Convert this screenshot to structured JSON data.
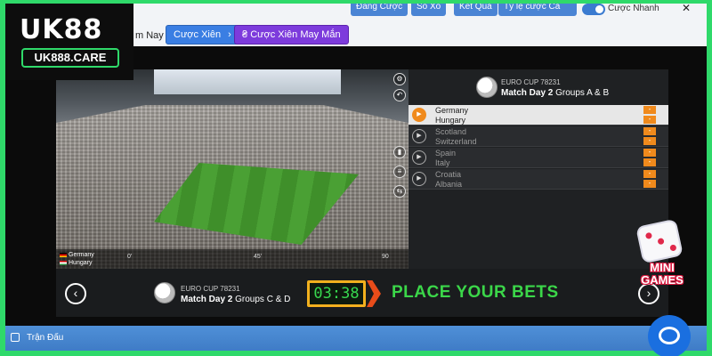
{
  "logo": {
    "main": "UK88",
    "sub": "UK888.CARE"
  },
  "top_buttons": [
    "Đăng Cược",
    "Sổ Xố",
    "Kết Quả",
    "Tỷ lệ cược Cả"
  ],
  "top_toggle_label": "Cược Nhanh",
  "nav": {
    "tab_label": "m Nay",
    "pill_cuoc_xien": "Cược Xiên",
    "pill_cuoc_xien_may_man": "Cược Xiên May Mắn",
    "pill_prefix": "₴"
  },
  "video": {
    "team_home": "Germany",
    "team_away": "Hungary",
    "ticks": [
      "0'",
      "45'",
      "90"
    ]
  },
  "panel": {
    "event_line": "EURO CUP 78231",
    "match_day": "Match Day 2",
    "groups": "Groups A & B",
    "matches": [
      {
        "home": "Germany",
        "away": "Hungary",
        "active": true
      },
      {
        "home": "Scotland",
        "away": "Switzerland",
        "active": false
      },
      {
        "home": "Spain",
        "away": "Italy",
        "active": false
      },
      {
        "home": "Croatia",
        "away": "Albania",
        "active": false
      }
    ]
  },
  "band": {
    "event_line": "EURO CUP 78231",
    "match_day": "Match Day 2",
    "groups": "Groups C & D",
    "timer": "03:38",
    "cta": "PLACE YOUR BETS"
  },
  "mini_games": {
    "line1": "MINI",
    "line2": "GAMES"
  },
  "bottom_bar": {
    "label": "Trận Đấu"
  },
  "colors": {
    "border": "#2fd96a",
    "accent_orange": "#f08a1c",
    "timer_green": "#37d94f",
    "cta_green": "#3bd649",
    "primary_blue": "#3a7ee3",
    "purple": "#7d3bdc"
  },
  "icons": [
    "stadium-video",
    "football-icon",
    "play-icon",
    "chevron-left-icon",
    "chevron-right-icon",
    "chat-icon",
    "dice-icon"
  ]
}
